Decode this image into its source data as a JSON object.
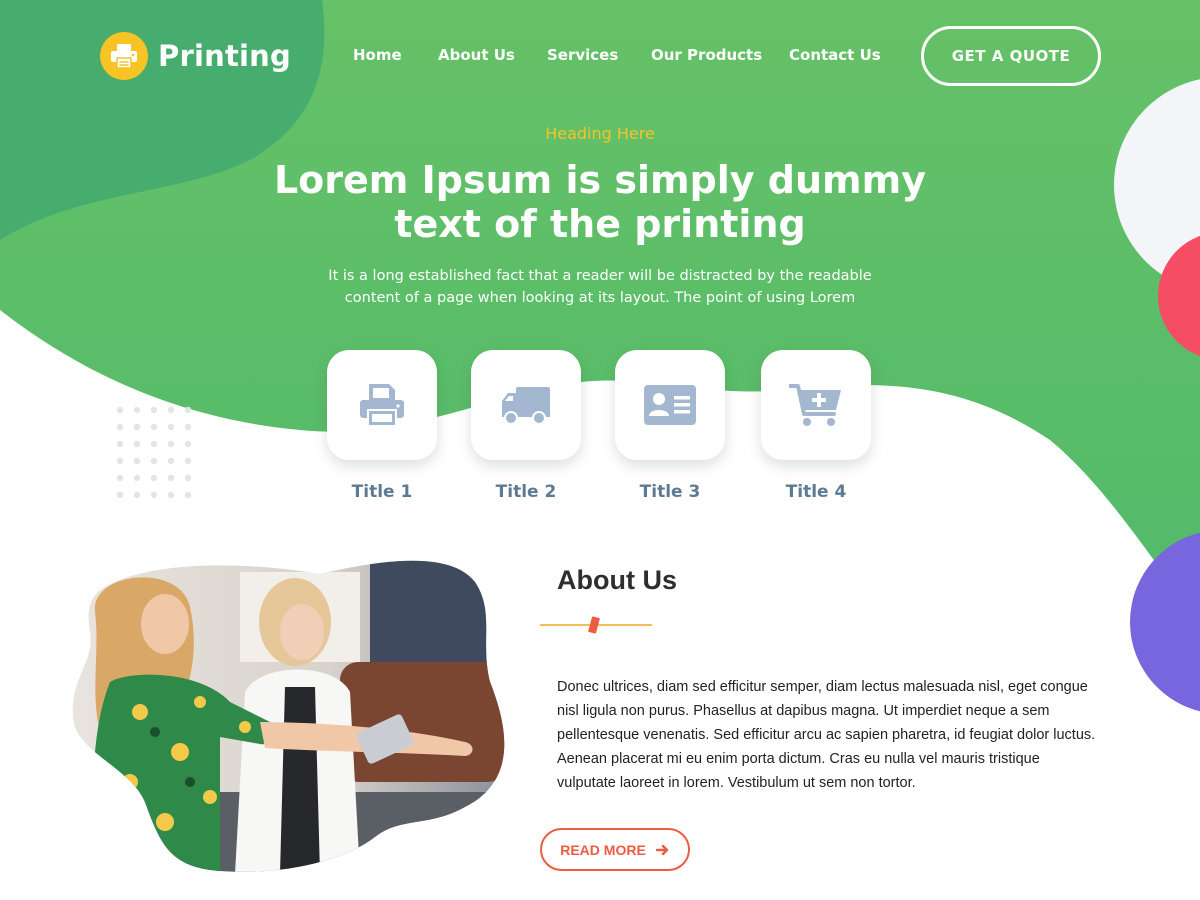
{
  "brand": {
    "name": "Printing",
    "logo_icon": "printer-icon",
    "primary_color": "#5cbf68",
    "accent_color": "#f7c325",
    "button_color": "#ef5a44",
    "decor_red": "#f54d63",
    "decor_purple": "#7766dd"
  },
  "nav": {
    "items": [
      {
        "label": "Home"
      },
      {
        "label": "About Us"
      },
      {
        "label": "Services"
      },
      {
        "label": "Our Products"
      },
      {
        "label": "Contact Us"
      }
    ],
    "cta_label": "GET A QUOTE"
  },
  "hero": {
    "kicker": "Heading Here",
    "title": "Lorem Ipsum is simply dummy text of the printing",
    "description": "It is a long established fact that a reader will be distracted by the readable content of a page when looking at its layout. The point of using Lorem"
  },
  "features": [
    {
      "title": "Title 1",
      "icon": "printer-icon"
    },
    {
      "title": "Title 2",
      "icon": "truck-icon"
    },
    {
      "title": "Title 3",
      "icon": "id-card-icon"
    },
    {
      "title": "Title 4",
      "icon": "cart-plus-icon"
    }
  ],
  "about": {
    "title": "About Us",
    "body": "Donec ultrices, diam sed efficitur semper, diam lectus malesuada nisl, eget congue nisl ligula non purus. Phasellus at dapibus magna. Ut imperdiet neque a sem pellentesque venenatis. Sed efficitur arcu ac sapien pharetra, id feugiat dolor luctus. Aenean placerat mi eu enim porta dictum. Cras eu nulla vel mauris tristique vulputate laoreet in lorem. Vestibulum ut sem non tortor.",
    "button_label": "READ MORE",
    "button_icon": "arrow-right-icon"
  }
}
